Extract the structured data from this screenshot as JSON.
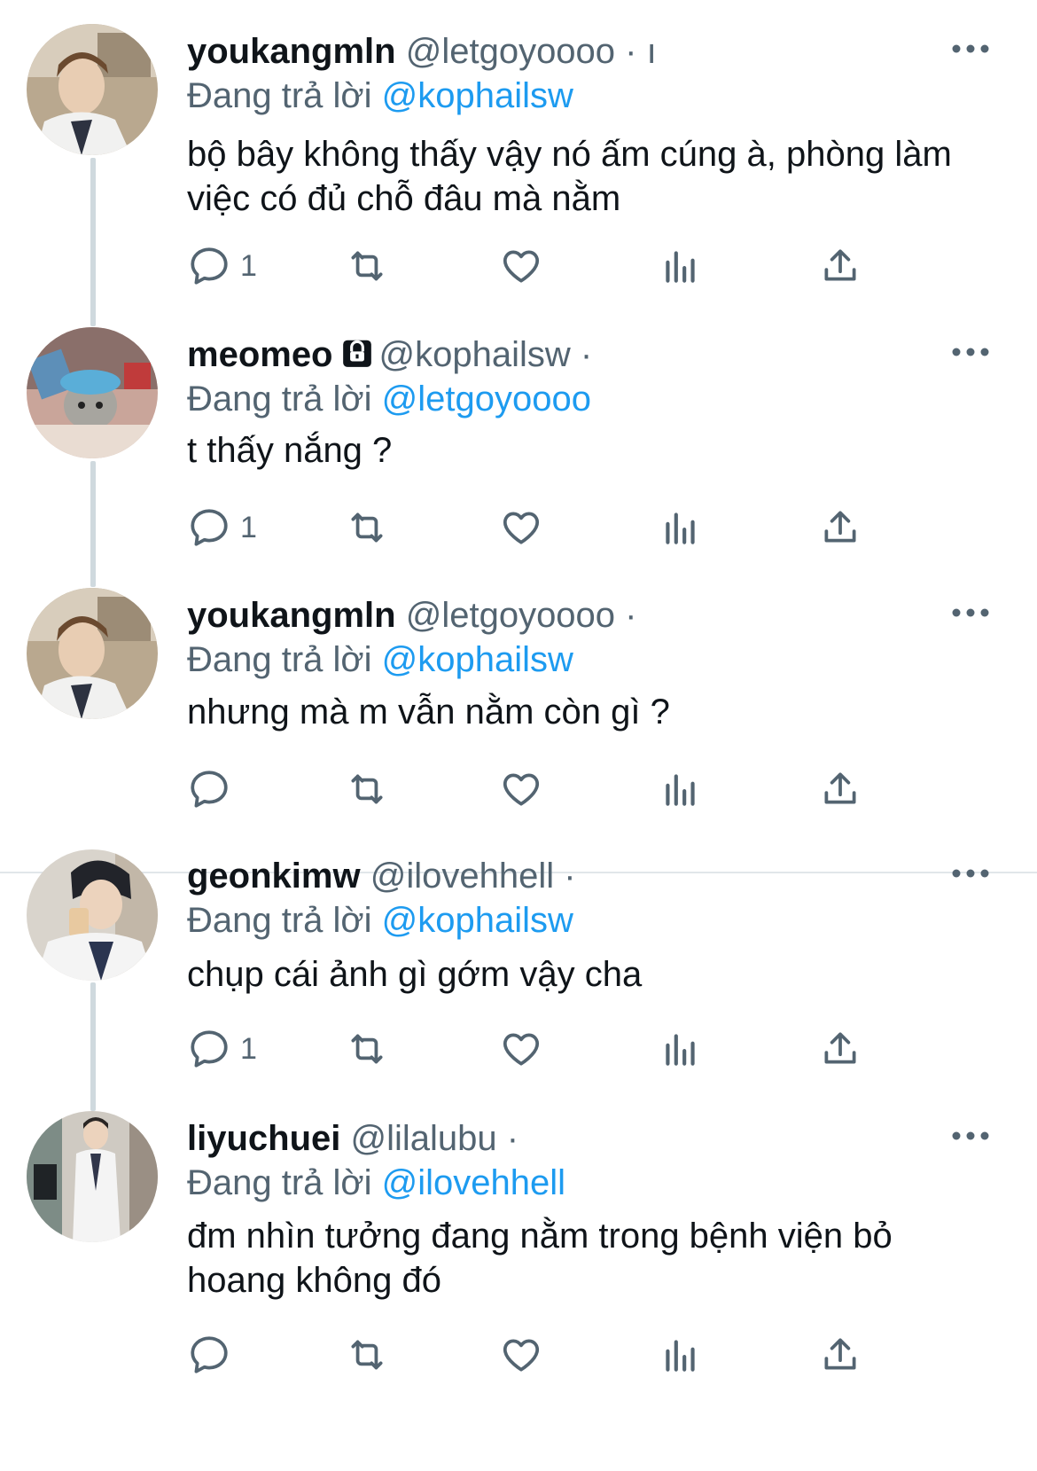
{
  "tweets": [
    {
      "name": "youkangmln",
      "handle": "@letgoyoooo",
      "meta": "· ı",
      "reply_prefix": "Đang trả lời",
      "reply_to": "@kophailsw",
      "text": "bộ bây không thấy vậy nó ấm cúng à, phòng làm việc có đủ chỗ đâu mà nằm",
      "reply_count": "1",
      "locked": false,
      "avatar_icon": "doctor-photo-avatar-icon"
    },
    {
      "name": "meomeo",
      "handle": "@kophailsw",
      "meta": "·",
      "reply_prefix": "Đang trả lời",
      "reply_to": "@letgoyoooo",
      "text": "t thấy nắng ?",
      "reply_count": "1",
      "locked": true,
      "avatar_icon": "cat-photo-avatar-icon"
    },
    {
      "name": "youkangmln",
      "handle": "@letgoyoooo",
      "meta": "·",
      "reply_prefix": "Đang trả lời",
      "reply_to": "@kophailsw",
      "text": "nhưng mà m vẫn nằm còn gì ?",
      "reply_count": "",
      "locked": false,
      "avatar_icon": "doctor-photo-avatar-icon"
    },
    {
      "name": "geonkimw",
      "handle": "@ilovehhell",
      "meta": "·",
      "reply_prefix": "Đang trả lời",
      "reply_to": "@kophailsw",
      "text": "chụp cái ảnh gì gớm vậy cha",
      "reply_count": "1",
      "locked": false,
      "avatar_icon": "doctor-drinking-avatar-icon"
    },
    {
      "name": "liyuchuei",
      "handle": "@lilalubu",
      "meta": "·",
      "reply_prefix": "Đang trả lời",
      "reply_to": "@ilovehhell",
      "text": "đm nhìn tưởng đang nằm trong bệnh viện bỏ hoang không đó",
      "reply_count": "",
      "locked": false,
      "avatar_icon": "doctor-standing-avatar-icon"
    }
  ],
  "colors": {
    "accent": "#1d9bf0",
    "secondary_text": "#536471",
    "thread_line": "#cfd9de"
  }
}
